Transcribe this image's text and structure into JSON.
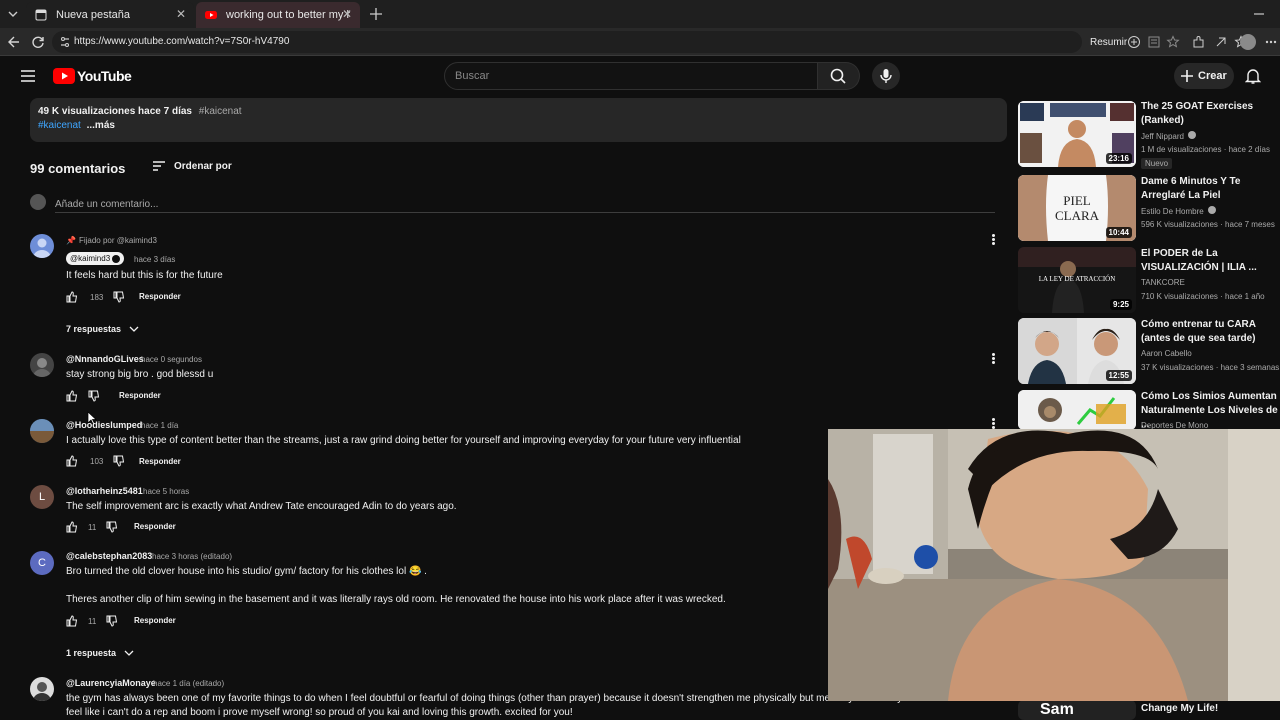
{
  "browser": {
    "tabs": [
      {
        "title": "Nueva pestaña",
        "active": false
      },
      {
        "title": "working out to better my health d",
        "active": true
      }
    ],
    "url": "https://www.youtube.com/watch?v=7S0r-hV4790",
    "summarize_label": "Resumir"
  },
  "youtube": {
    "logo_text": "YouTube",
    "search_placeholder": "Buscar",
    "create_label": "Crear"
  },
  "description": {
    "stats": "49 K visualizaciones  hace 7 días",
    "tag1": "#kaicenat",
    "tag2": "#kaicenat",
    "more": "...más"
  },
  "comments_header": {
    "count": "99 comentarios",
    "sort": "Ordenar por",
    "add_placeholder": "Añade un comentario..."
  },
  "comments": [
    {
      "pinned": "Fijado por @kaimind3",
      "handle": "@kaimind3",
      "time": "hace 3 días",
      "text": "It feels hard but this is for the future",
      "likes": "183",
      "reply": "Responder",
      "replies": "7 respuestas"
    },
    {
      "handle": "@NnnandoGLives",
      "time": "hace 0 segundos",
      "text": "stay strong big bro . god blessd u",
      "likes": "",
      "reply": "Responder"
    },
    {
      "handle": "@Hoodieslumped",
      "time": "hace 1 día",
      "text": "I actually love this type of content better than the streams, just a raw grind doing better for yourself and improving everyday for your future very influential",
      "likes": "103",
      "reply": "Responder"
    },
    {
      "handle": "@lotharheinz5481",
      "time": "hace 5 horas",
      "text": "The self improvement arc is exactly what Andrew Tate encouraged Adin to do years ago.",
      "likes": "11",
      "reply": "Responder",
      "avatar_letter": "L"
    },
    {
      "handle": "@calebstephan2083",
      "time": "hace 3 horas (editado)",
      "text": "Bro turned the old clover house into his studio/ gym/ factory for his clothes lol 😂 .",
      "text2": "Theres another clip of him sewing in the basement and it was literally rays old room. He renovated the house into his work place after it was wrecked.",
      "likes": "11",
      "reply": "Responder",
      "replies": "1 respuesta",
      "avatar_letter": "C"
    },
    {
      "handle": "@LaurencyiaMonaye",
      "time": "hace 1 día (editado)",
      "text": "the gym has always been one of my favorite things to do when I feel doubtful or fearful of doing things (other than prayer) because it doesn't strengthen me physically but mentally too he says I don't wanna worked,",
      "text2": "feel like i can't do a rep and boom i prove myself wrong! so proud of you kai and loving this growth. excited for you!"
    }
  ],
  "sidebar": [
    {
      "title": "The 25 GOAT Exercises (Ranked)",
      "channel": "Jeff Nippard",
      "meta": "1 M de visualizaciones · hace 2 días",
      "badge": "Nuevo",
      "duration": "23:16",
      "verified": true
    },
    {
      "title": "Dame 6 Minutos Y Te Arreglaré La Piel",
      "channel": "Estilo De Hombre",
      "meta": "596 K visualizaciones · hace 7 meses",
      "duration": "10:44",
      "thumb_text": "PIEL CLARA",
      "verified": true
    },
    {
      "title": "El PODER de La VISUALIZACIÓN | ILIA ...",
      "channel": "TANKCORE",
      "meta": "710 K visualizaciones · hace 1 año",
      "duration": "9:25",
      "thumb_text": "LA LEY DE ATRACCIÓN"
    },
    {
      "title": "Cómo entrenar tu CARA (antes de que sea tarde)",
      "channel": "Aaron Cabello",
      "meta": "37 K visualizaciones · hace 3 semanas",
      "duration": "12:55"
    },
    {
      "title": "Cómo Los Simios Aumentan Naturalmente Los Niveles de ...",
      "channel": "Deportes De Mono",
      "meta": "",
      "duration": ""
    },
    {
      "title": "Change My Life!",
      "channel": "",
      "meta": "",
      "duration": "",
      "thumb_text": "Sam"
    }
  ],
  "colors": {
    "accent_red": "#ff0000",
    "link_blue": "#3ea6ff",
    "background": "#0f0f0f"
  }
}
